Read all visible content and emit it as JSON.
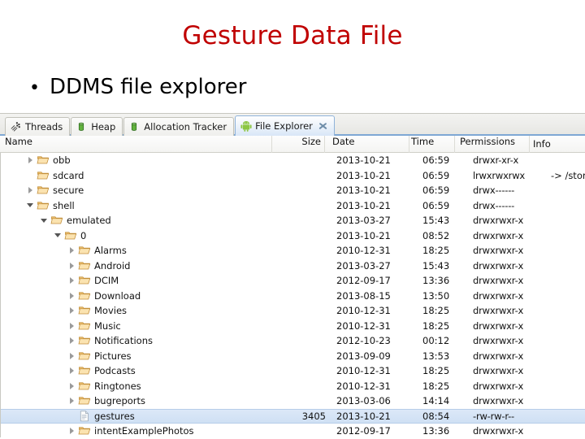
{
  "slide": {
    "title": "Gesture Data File",
    "title_color": "#C00000",
    "bullet_text": "DDMS file explorer",
    "bullet_marker": "•"
  },
  "ddms": {
    "tabs": [
      {
        "label": "Threads",
        "icon": "threads-icon",
        "active": false,
        "closable": false
      },
      {
        "label": "Heap",
        "icon": "heap-icon",
        "active": false,
        "closable": false
      },
      {
        "label": "Allocation Tracker",
        "icon": "allocation-tracker-icon",
        "active": false,
        "closable": false
      },
      {
        "label": "File Explorer",
        "icon": "android-icon",
        "active": true,
        "closable": true
      }
    ],
    "columns": [
      "Name",
      "Size",
      "Date",
      "Time",
      "Permissions",
      "Info"
    ],
    "selection_color": "#D3E2F4",
    "rows": [
      {
        "name": "obb",
        "depth": 1,
        "icon": "folder-icon",
        "twisty": "collapsed",
        "size": "",
        "date": "2013-10-21",
        "time": "06:59",
        "permissions": "drwxr-xr-x",
        "info": "",
        "selected": false
      },
      {
        "name": "sdcard",
        "depth": 1,
        "icon": "folder-icon",
        "twisty": "none",
        "size": "",
        "date": "2013-10-21",
        "time": "06:59",
        "permissions": "lrwxrwxrwx",
        "info": "-> /storage/em",
        "selected": false
      },
      {
        "name": "secure",
        "depth": 1,
        "icon": "folder-icon",
        "twisty": "collapsed",
        "size": "",
        "date": "2013-10-21",
        "time": "06:59",
        "permissions": "drwx------",
        "info": "",
        "selected": false
      },
      {
        "name": "shell",
        "depth": 1,
        "icon": "folder-icon",
        "twisty": "expanded",
        "size": "",
        "date": "2013-10-21",
        "time": "06:59",
        "permissions": "drwx------",
        "info": "",
        "selected": false
      },
      {
        "name": "emulated",
        "depth": 2,
        "icon": "folder-icon",
        "twisty": "expanded",
        "size": "",
        "date": "2013-03-27",
        "time": "15:43",
        "permissions": "drwxrwxr-x",
        "info": "",
        "selected": false
      },
      {
        "name": "0",
        "depth": 3,
        "icon": "folder-icon",
        "twisty": "expanded",
        "size": "",
        "date": "2013-10-21",
        "time": "08:52",
        "permissions": "drwxrwxr-x",
        "info": "",
        "selected": false
      },
      {
        "name": "Alarms",
        "depth": 4,
        "icon": "folder-icon",
        "twisty": "collapsed",
        "size": "",
        "date": "2010-12-31",
        "time": "18:25",
        "permissions": "drwxrwxr-x",
        "info": "",
        "selected": false
      },
      {
        "name": "Android",
        "depth": 4,
        "icon": "folder-icon",
        "twisty": "collapsed",
        "size": "",
        "date": "2013-03-27",
        "time": "15:43",
        "permissions": "drwxrwxr-x",
        "info": "",
        "selected": false
      },
      {
        "name": "DCIM",
        "depth": 4,
        "icon": "folder-icon",
        "twisty": "collapsed",
        "size": "",
        "date": "2012-09-17",
        "time": "13:36",
        "permissions": "drwxrwxr-x",
        "info": "",
        "selected": false
      },
      {
        "name": "Download",
        "depth": 4,
        "icon": "folder-icon",
        "twisty": "collapsed",
        "size": "",
        "date": "2013-08-15",
        "time": "13:50",
        "permissions": "drwxrwxr-x",
        "info": "",
        "selected": false
      },
      {
        "name": "Movies",
        "depth": 4,
        "icon": "folder-icon",
        "twisty": "collapsed",
        "size": "",
        "date": "2010-12-31",
        "time": "18:25",
        "permissions": "drwxrwxr-x",
        "info": "",
        "selected": false
      },
      {
        "name": "Music",
        "depth": 4,
        "icon": "folder-icon",
        "twisty": "collapsed",
        "size": "",
        "date": "2010-12-31",
        "time": "18:25",
        "permissions": "drwxrwxr-x",
        "info": "",
        "selected": false
      },
      {
        "name": "Notifications",
        "depth": 4,
        "icon": "folder-icon",
        "twisty": "collapsed",
        "size": "",
        "date": "2012-10-23",
        "time": "00:12",
        "permissions": "drwxrwxr-x",
        "info": "",
        "selected": false
      },
      {
        "name": "Pictures",
        "depth": 4,
        "icon": "folder-icon",
        "twisty": "collapsed",
        "size": "",
        "date": "2013-09-09",
        "time": "13:53",
        "permissions": "drwxrwxr-x",
        "info": "",
        "selected": false
      },
      {
        "name": "Podcasts",
        "depth": 4,
        "icon": "folder-icon",
        "twisty": "collapsed",
        "size": "",
        "date": "2010-12-31",
        "time": "18:25",
        "permissions": "drwxrwxr-x",
        "info": "",
        "selected": false
      },
      {
        "name": "Ringtones",
        "depth": 4,
        "icon": "folder-icon",
        "twisty": "collapsed",
        "size": "",
        "date": "2010-12-31",
        "time": "18:25",
        "permissions": "drwxrwxr-x",
        "info": "",
        "selected": false
      },
      {
        "name": "bugreports",
        "depth": 4,
        "icon": "folder-icon",
        "twisty": "collapsed",
        "size": "",
        "date": "2013-03-06",
        "time": "14:14",
        "permissions": "drwxrwxr-x",
        "info": "",
        "selected": false
      },
      {
        "name": "gestures",
        "depth": 4,
        "icon": "file-icon",
        "twisty": "none",
        "size": "3405",
        "date": "2013-10-21",
        "time": "08:54",
        "permissions": "-rw-rw-r--",
        "info": "",
        "selected": true
      },
      {
        "name": "intentExamplePhotos",
        "depth": 4,
        "icon": "folder-icon",
        "twisty": "collapsed",
        "size": "",
        "date": "2012-09-17",
        "time": "13:36",
        "permissions": "drwxrwxr-x",
        "info": "",
        "selected": false
      }
    ]
  }
}
